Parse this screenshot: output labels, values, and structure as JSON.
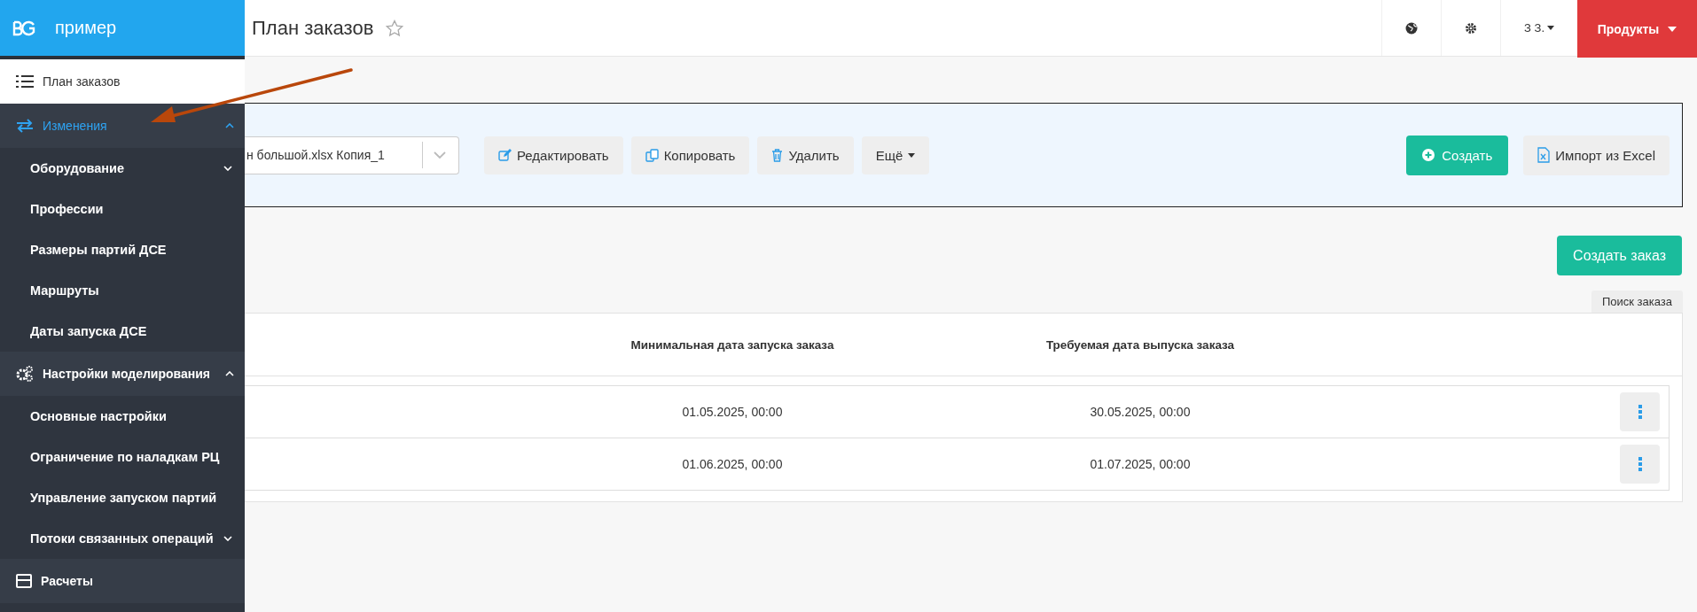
{
  "header": {
    "title": "План заказов",
    "favorite": false,
    "user": "З З.",
    "products_button": "Продукты"
  },
  "sidebar": {
    "brand": "пример",
    "items": [
      {
        "label": "План заказов",
        "selected": true,
        "active": false,
        "expanded": false
      },
      {
        "label": "Изменения",
        "selected": false,
        "active": true,
        "expanded": true,
        "children": [
          {
            "label": "Оборудование",
            "has_submenu": true
          },
          {
            "label": "Профессии",
            "has_submenu": false
          },
          {
            "label": "Размеры партий ДСЕ",
            "has_submenu": false
          },
          {
            "label": "Маршруты",
            "has_submenu": false
          },
          {
            "label": "Даты запуска ДСЕ",
            "has_submenu": false
          }
        ]
      },
      {
        "label": "Настройки моделирования",
        "selected": false,
        "active": false,
        "expanded": true,
        "children": [
          {
            "label": "Основные настройки",
            "has_submenu": false
          },
          {
            "label": "Ограничение по наладкам РЦ",
            "has_submenu": false
          },
          {
            "label": "Управление запуском партий",
            "has_submenu": false
          },
          {
            "label": "Потоки связанных операций",
            "has_submenu": true
          }
        ]
      },
      {
        "label": "Расчеты",
        "selected": false,
        "active": false,
        "expanded": false
      }
    ]
  },
  "toolbar": {
    "file_select": {
      "value": "н большой.xlsx Копия_1"
    },
    "buttons": [
      {
        "label": "Редактировать",
        "kind": "edit"
      },
      {
        "label": "Копировать",
        "kind": "copy"
      },
      {
        "label": "Удалить",
        "kind": "delete"
      },
      {
        "label": "Ещё",
        "kind": "dropdown"
      }
    ],
    "create_button": "Создать",
    "import_button": "Импорт из Excel"
  },
  "create_order_button": "Создать заказ",
  "search_tab": "Поиск заказа",
  "table": {
    "columns": [
      "Минимальная дата запуска заказа",
      "Требуемая дата выпуска заказа"
    ],
    "rows": [
      {
        "min_start": "01.05.2025, 00:00",
        "required_release": "30.05.2025, 00:00"
      },
      {
        "min_start": "01.06.2025, 00:00",
        "required_release": "01.07.2025, 00:00"
      }
    ]
  }
}
